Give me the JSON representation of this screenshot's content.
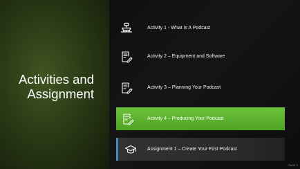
{
  "slide": {
    "title_line1": "Activities and",
    "title_line2": "Assignment",
    "page_label": "PAGE 3"
  },
  "items": [
    {
      "label": "Activity 1 - What Is A Podcast",
      "icon": "podcast-mic-icon"
    },
    {
      "label": "Activity 2 – Equipment and Software",
      "icon": "checklist-pencil-icon"
    },
    {
      "label": "Activity 3 – Planning Your Podcast",
      "icon": "checklist-pencil-icon"
    },
    {
      "label": "Activity 4 – Producing Your Podcast",
      "icon": "checklist-pencil-icon",
      "active": true
    },
    {
      "label": "Assignment 1 – Create Your First Podcast",
      "icon": "graduation-cap-icon"
    }
  ],
  "colors": {
    "active": "#5db32f",
    "accent_blue": "#3b8fb8",
    "left_panel": "#33461a"
  }
}
